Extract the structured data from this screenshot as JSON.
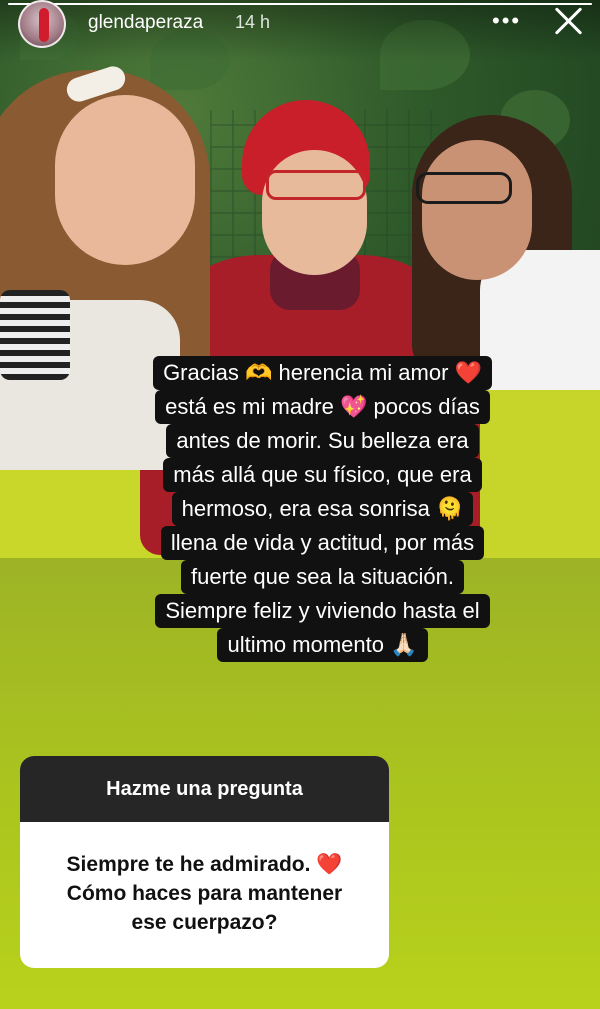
{
  "story": {
    "progress": 1.0,
    "username": "glendaperaza",
    "time": "14 h",
    "more_label": "•••"
  },
  "caption": {
    "lines": [
      "Gracias 🫶 herencia mi amor ❤️",
      "está es mi madre 💖 pocos días",
      "antes de morir. Su belleza era",
      "más allá que su físico, que era",
      "hermoso, era esa sonrisa 🫠",
      "llena de vida y actitud, por más",
      "fuerte que sea la situación.",
      "Siempre feliz y viviendo hasta el",
      "ultimo momento 🙏🏻"
    ]
  },
  "question": {
    "header": "Hazme una pregunta",
    "lines": [
      "Siempre te he admirado. ❤️",
      "Cómo haces para mantener",
      "ese cuerpazo?"
    ]
  },
  "icons": [
    "more-icon",
    "close-icon"
  ],
  "colors": {
    "background_top": "#8a9c2e",
    "background_bottom": "#b8d21c",
    "question_header": "#262626"
  }
}
